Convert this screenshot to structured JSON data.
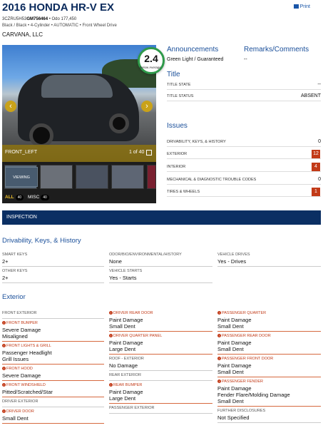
{
  "header": {
    "title": "2016 HONDA HR-V EX",
    "print_label": "Print",
    "vin_prefix": "3CZRU5H53",
    "vin_bold": "GM756464",
    "odo": "• Odo 177,450",
    "details": "Black / Black • 4-Cylinder • AUTOMATIC • Front Wheel Drive",
    "seller": "CARVANA, LLC"
  },
  "gallery": {
    "caption": "FRONT_LEFT",
    "count": "1 of 40",
    "viewing_label": "VIEWING",
    "filter_all": "ALL",
    "all_count": "40",
    "filter_misc": "MISC",
    "misc_count": "40"
  },
  "score": {
    "value": "2.4",
    "label": "Below Average",
    "color": "#2f9a4a"
  },
  "announcements": {
    "heading": "Announcements",
    "text": "Green Light / Guaranteed"
  },
  "remarks": {
    "heading": "Remarks/Comments",
    "text": "--"
  },
  "title_section": {
    "heading": "Title",
    "rows": [
      {
        "key": "TITLE STATE",
        "value": "--"
      },
      {
        "key": "TITLE STATUS",
        "value": "ABSENT"
      }
    ]
  },
  "issues": {
    "heading": "Issues",
    "rows": [
      {
        "key": "DRIVABILITY, KEYS, & HISTORY",
        "value": "0"
      },
      {
        "key": "EXTERIOR",
        "value": "12"
      },
      {
        "key": "INTERIOR",
        "value": "4"
      },
      {
        "key": "MECHANICAL & DIAGNOSTIC TROUBLE CODES",
        "value": "0"
      },
      {
        "key": "TIRES & WHEELS",
        "value": "1"
      }
    ]
  },
  "inspection_bar": "INSPECTION",
  "drivability": {
    "heading": "Drivability, Keys, & History",
    "smart_keys_label": "SMART KEYS",
    "smart_keys": "2+",
    "other_keys_label": "OTHER KEYS",
    "other_keys": "2+",
    "odor_label": "ODOR/BIO/ENVIRONMENTAL/HISTORY",
    "odor": "None",
    "starts_label": "VEHICLE STARTS",
    "starts": "Yes - Starts",
    "drives_label": "VEHICLE DRIVES",
    "drives": "Yes - Drives"
  },
  "exterior": {
    "heading": "Exterior",
    "col1": [
      {
        "label": "FRONT EXTERIOR",
        "damaged": false,
        "values": []
      },
      {
        "label": "FRONT BUMPER",
        "damaged": true,
        "values": [
          "Severe Damage",
          "Misaligned"
        ]
      },
      {
        "label": "FRONT LIGHTS & GRILL",
        "damaged": true,
        "values": [
          "Passenger Headlight",
          "Grill Issues"
        ]
      },
      {
        "label": "FRONT HOOD",
        "damaged": true,
        "values": [
          "Severe Damage"
        ]
      },
      {
        "label": "FRONT WINDSHIELD",
        "damaged": true,
        "values": [
          "Pitted/Scratched/Star"
        ]
      },
      {
        "label": "DRIVER EXTERIOR",
        "damaged": false,
        "values": []
      },
      {
        "label": "DRIVER DOOR",
        "damaged": true,
        "values": [
          "Small Dent"
        ]
      }
    ],
    "col2": [
      {
        "label": "DRIVER REAR DOOR",
        "damaged": true,
        "values": [
          "Paint Damage",
          "Small Dent"
        ]
      },
      {
        "label": "DRIVER QUARTER PANEL",
        "damaged": true,
        "values": [
          "Paint Damage",
          "Large Dent"
        ]
      },
      {
        "label": "ROOF - EXTERIOR",
        "damaged": false,
        "values": [
          "No Damage"
        ]
      },
      {
        "label": "REAR EXTERIOR",
        "damaged": false,
        "values": []
      },
      {
        "label": "REAR BUMPER",
        "damaged": true,
        "values": [
          "Paint Damage",
          "Large Dent"
        ]
      },
      {
        "label": "PASSENGER EXTERIOR",
        "damaged": false,
        "values": []
      }
    ],
    "col3": [
      {
        "label": "PASSENGER QUARTER",
        "damaged": true,
        "values": [
          "Paint Damage",
          "Small Dent"
        ]
      },
      {
        "label": "PASSENGER REAR DOOR",
        "damaged": true,
        "values": [
          "Paint Damage",
          "Small Dent"
        ]
      },
      {
        "label": "PASSENGER FRONT DOOR",
        "damaged": true,
        "values": [
          "Paint Damage",
          "Small Dent"
        ]
      },
      {
        "label": "PASSENGER FENDER",
        "damaged": true,
        "values": [
          "Paint Damage",
          "Fender Flare/Molding Damage",
          "Small Dent"
        ]
      },
      {
        "label": "FURTHER DISCLOSURES",
        "damaged": false,
        "values": [
          "Not Specified"
        ]
      }
    ]
  }
}
